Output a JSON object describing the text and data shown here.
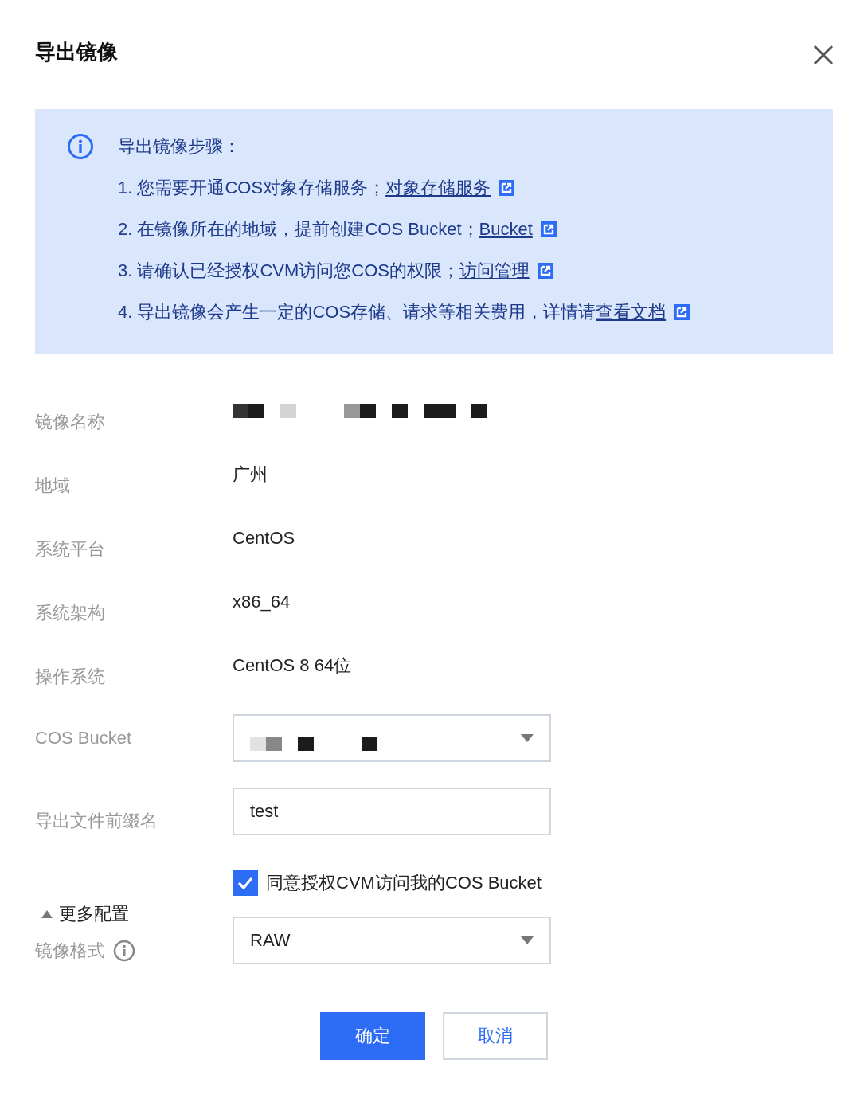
{
  "dialog": {
    "title": "导出镜像"
  },
  "notice": {
    "heading": "导出镜像步骤：",
    "steps": [
      {
        "text": "1. 您需要开通COS对象存储服务；",
        "link": "对象存储服务"
      },
      {
        "text": "2. 在镜像所在的地域，提前创建COS Bucket；",
        "link": "Bucket"
      },
      {
        "text": "3. 请确认已经授权CVM访问您COS的权限；",
        "link": "访问管理"
      },
      {
        "text": "4. 导出镜像会产生一定的COS存储、请求等相关费用，详情请",
        "link": "查看文档"
      }
    ]
  },
  "form": {
    "fields": [
      {
        "label": "镜像名称",
        "kind": "redacted"
      },
      {
        "label": "地域",
        "kind": "text",
        "value": "广州"
      },
      {
        "label": "系统平台",
        "kind": "text",
        "value": "CentOS"
      },
      {
        "label": "系统架构",
        "kind": "text",
        "value": "x86_64"
      },
      {
        "label": "操作系统",
        "kind": "text",
        "value": "CentOS 8 64位"
      },
      {
        "label": "COS Bucket",
        "kind": "redacted-select"
      },
      {
        "label": "导出文件前缀名",
        "kind": "input",
        "value": "test"
      }
    ],
    "agreement": {
      "label": "同意授权CVM访问我的COS Bucket",
      "checked": true
    },
    "more_config": {
      "label": "更多配置",
      "expanded": true
    },
    "image_format": {
      "label": "镜像格式",
      "value": "RAW"
    }
  },
  "buttons": [
    {
      "label": "确定",
      "kind": "primary"
    },
    {
      "label": "取消",
      "kind": "secondary"
    }
  ]
}
